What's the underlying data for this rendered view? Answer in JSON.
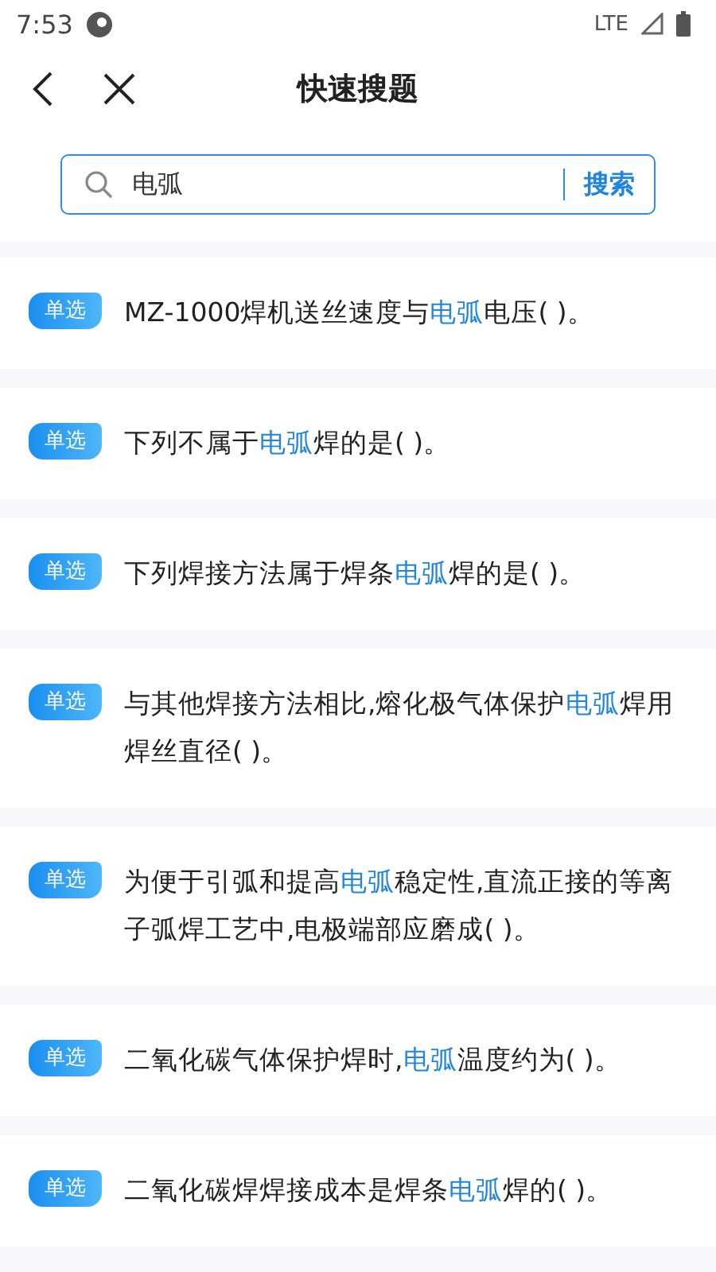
{
  "status_bar": {
    "time": "7:53",
    "network": "LTE"
  },
  "header": {
    "title": "快速搜题"
  },
  "search": {
    "value": "电弧",
    "button": "搜索"
  },
  "results": [
    {
      "badge": "单选",
      "segments": [
        {
          "text": "MZ-1000焊机送丝速度与",
          "highlight": false
        },
        {
          "text": "电弧",
          "highlight": true
        },
        {
          "text": "电压( )。",
          "highlight": false
        }
      ]
    },
    {
      "badge": "单选",
      "segments": [
        {
          "text": "下列不属于",
          "highlight": false
        },
        {
          "text": "电弧",
          "highlight": true
        },
        {
          "text": "焊的是( )。",
          "highlight": false
        }
      ]
    },
    {
      "badge": "单选",
      "segments": [
        {
          "text": "下列焊接方法属于焊条",
          "highlight": false
        },
        {
          "text": "电弧",
          "highlight": true
        },
        {
          "text": "焊的是( )。",
          "highlight": false
        }
      ]
    },
    {
      "badge": "单选",
      "segments": [
        {
          "text": "与其他焊接方法相比,熔化极气体保护",
          "highlight": false
        },
        {
          "text": "电弧",
          "highlight": true
        },
        {
          "text": "焊用焊丝直径( )。",
          "highlight": false
        }
      ]
    },
    {
      "badge": "单选",
      "segments": [
        {
          "text": "为便于引弧和提高",
          "highlight": false
        },
        {
          "text": "电弧",
          "highlight": true
        },
        {
          "text": "稳定性,直流正接的等离子弧焊工艺中,电极端部应磨成( )。",
          "highlight": false
        }
      ]
    },
    {
      "badge": "单选",
      "segments": [
        {
          "text": "二氧化碳气体保护焊时,",
          "highlight": false
        },
        {
          "text": "电弧",
          "highlight": true
        },
        {
          "text": "温度约为( )。",
          "highlight": false
        }
      ]
    },
    {
      "badge": "单选",
      "segments": [
        {
          "text": "二氧化碳焊焊接成本是焊条",
          "highlight": false
        },
        {
          "text": "电弧",
          "highlight": true
        },
        {
          "text": "焊的( )。",
          "highlight": false
        }
      ]
    }
  ]
}
